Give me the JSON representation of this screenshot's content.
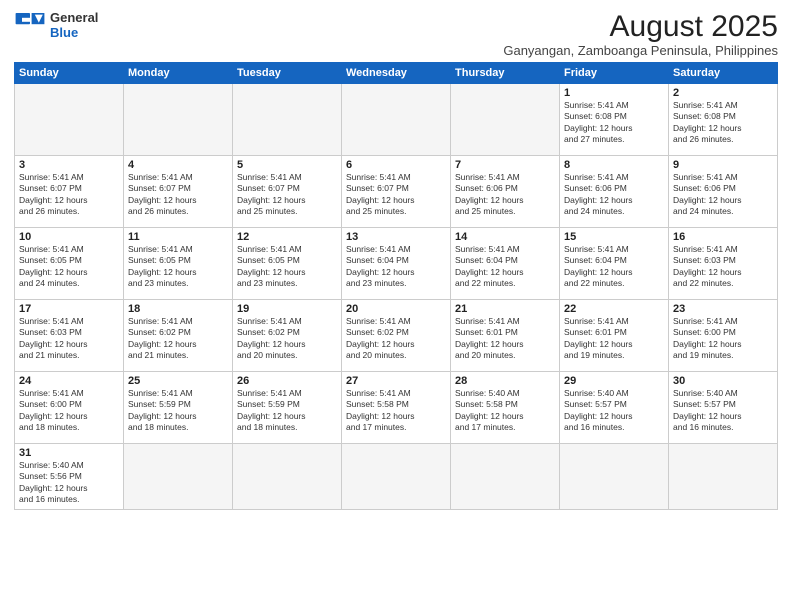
{
  "header": {
    "logo_line1": "General",
    "logo_line2": "Blue",
    "month_title": "August 2025",
    "location": "Ganyangan, Zamboanga Peninsula, Philippines"
  },
  "days_of_week": [
    "Sunday",
    "Monday",
    "Tuesday",
    "Wednesday",
    "Thursday",
    "Friday",
    "Saturday"
  ],
  "weeks": [
    [
      {
        "day": "",
        "info": ""
      },
      {
        "day": "",
        "info": ""
      },
      {
        "day": "",
        "info": ""
      },
      {
        "day": "",
        "info": ""
      },
      {
        "day": "",
        "info": ""
      },
      {
        "day": "1",
        "info": "Sunrise: 5:41 AM\nSunset: 6:08 PM\nDaylight: 12 hours\nand 27 minutes."
      },
      {
        "day": "2",
        "info": "Sunrise: 5:41 AM\nSunset: 6:08 PM\nDaylight: 12 hours\nand 26 minutes."
      }
    ],
    [
      {
        "day": "3",
        "info": "Sunrise: 5:41 AM\nSunset: 6:07 PM\nDaylight: 12 hours\nand 26 minutes."
      },
      {
        "day": "4",
        "info": "Sunrise: 5:41 AM\nSunset: 6:07 PM\nDaylight: 12 hours\nand 26 minutes."
      },
      {
        "day": "5",
        "info": "Sunrise: 5:41 AM\nSunset: 6:07 PM\nDaylight: 12 hours\nand 25 minutes."
      },
      {
        "day": "6",
        "info": "Sunrise: 5:41 AM\nSunset: 6:07 PM\nDaylight: 12 hours\nand 25 minutes."
      },
      {
        "day": "7",
        "info": "Sunrise: 5:41 AM\nSunset: 6:06 PM\nDaylight: 12 hours\nand 25 minutes."
      },
      {
        "day": "8",
        "info": "Sunrise: 5:41 AM\nSunset: 6:06 PM\nDaylight: 12 hours\nand 24 minutes."
      },
      {
        "day": "9",
        "info": "Sunrise: 5:41 AM\nSunset: 6:06 PM\nDaylight: 12 hours\nand 24 minutes."
      }
    ],
    [
      {
        "day": "10",
        "info": "Sunrise: 5:41 AM\nSunset: 6:05 PM\nDaylight: 12 hours\nand 24 minutes."
      },
      {
        "day": "11",
        "info": "Sunrise: 5:41 AM\nSunset: 6:05 PM\nDaylight: 12 hours\nand 23 minutes."
      },
      {
        "day": "12",
        "info": "Sunrise: 5:41 AM\nSunset: 6:05 PM\nDaylight: 12 hours\nand 23 minutes."
      },
      {
        "day": "13",
        "info": "Sunrise: 5:41 AM\nSunset: 6:04 PM\nDaylight: 12 hours\nand 23 minutes."
      },
      {
        "day": "14",
        "info": "Sunrise: 5:41 AM\nSunset: 6:04 PM\nDaylight: 12 hours\nand 22 minutes."
      },
      {
        "day": "15",
        "info": "Sunrise: 5:41 AM\nSunset: 6:04 PM\nDaylight: 12 hours\nand 22 minutes."
      },
      {
        "day": "16",
        "info": "Sunrise: 5:41 AM\nSunset: 6:03 PM\nDaylight: 12 hours\nand 22 minutes."
      }
    ],
    [
      {
        "day": "17",
        "info": "Sunrise: 5:41 AM\nSunset: 6:03 PM\nDaylight: 12 hours\nand 21 minutes."
      },
      {
        "day": "18",
        "info": "Sunrise: 5:41 AM\nSunset: 6:02 PM\nDaylight: 12 hours\nand 21 minutes."
      },
      {
        "day": "19",
        "info": "Sunrise: 5:41 AM\nSunset: 6:02 PM\nDaylight: 12 hours\nand 20 minutes."
      },
      {
        "day": "20",
        "info": "Sunrise: 5:41 AM\nSunset: 6:02 PM\nDaylight: 12 hours\nand 20 minutes."
      },
      {
        "day": "21",
        "info": "Sunrise: 5:41 AM\nSunset: 6:01 PM\nDaylight: 12 hours\nand 20 minutes."
      },
      {
        "day": "22",
        "info": "Sunrise: 5:41 AM\nSunset: 6:01 PM\nDaylight: 12 hours\nand 19 minutes."
      },
      {
        "day": "23",
        "info": "Sunrise: 5:41 AM\nSunset: 6:00 PM\nDaylight: 12 hours\nand 19 minutes."
      }
    ],
    [
      {
        "day": "24",
        "info": "Sunrise: 5:41 AM\nSunset: 6:00 PM\nDaylight: 12 hours\nand 18 minutes."
      },
      {
        "day": "25",
        "info": "Sunrise: 5:41 AM\nSunset: 5:59 PM\nDaylight: 12 hours\nand 18 minutes."
      },
      {
        "day": "26",
        "info": "Sunrise: 5:41 AM\nSunset: 5:59 PM\nDaylight: 12 hours\nand 18 minutes."
      },
      {
        "day": "27",
        "info": "Sunrise: 5:41 AM\nSunset: 5:58 PM\nDaylight: 12 hours\nand 17 minutes."
      },
      {
        "day": "28",
        "info": "Sunrise: 5:40 AM\nSunset: 5:58 PM\nDaylight: 12 hours\nand 17 minutes."
      },
      {
        "day": "29",
        "info": "Sunrise: 5:40 AM\nSunset: 5:57 PM\nDaylight: 12 hours\nand 16 minutes."
      },
      {
        "day": "30",
        "info": "Sunrise: 5:40 AM\nSunset: 5:57 PM\nDaylight: 12 hours\nand 16 minutes."
      }
    ],
    [
      {
        "day": "31",
        "info": "Sunrise: 5:40 AM\nSunset: 5:56 PM\nDaylight: 12 hours\nand 16 minutes."
      },
      {
        "day": "",
        "info": ""
      },
      {
        "day": "",
        "info": ""
      },
      {
        "day": "",
        "info": ""
      },
      {
        "day": "",
        "info": ""
      },
      {
        "day": "",
        "info": ""
      },
      {
        "day": "",
        "info": ""
      }
    ]
  ]
}
